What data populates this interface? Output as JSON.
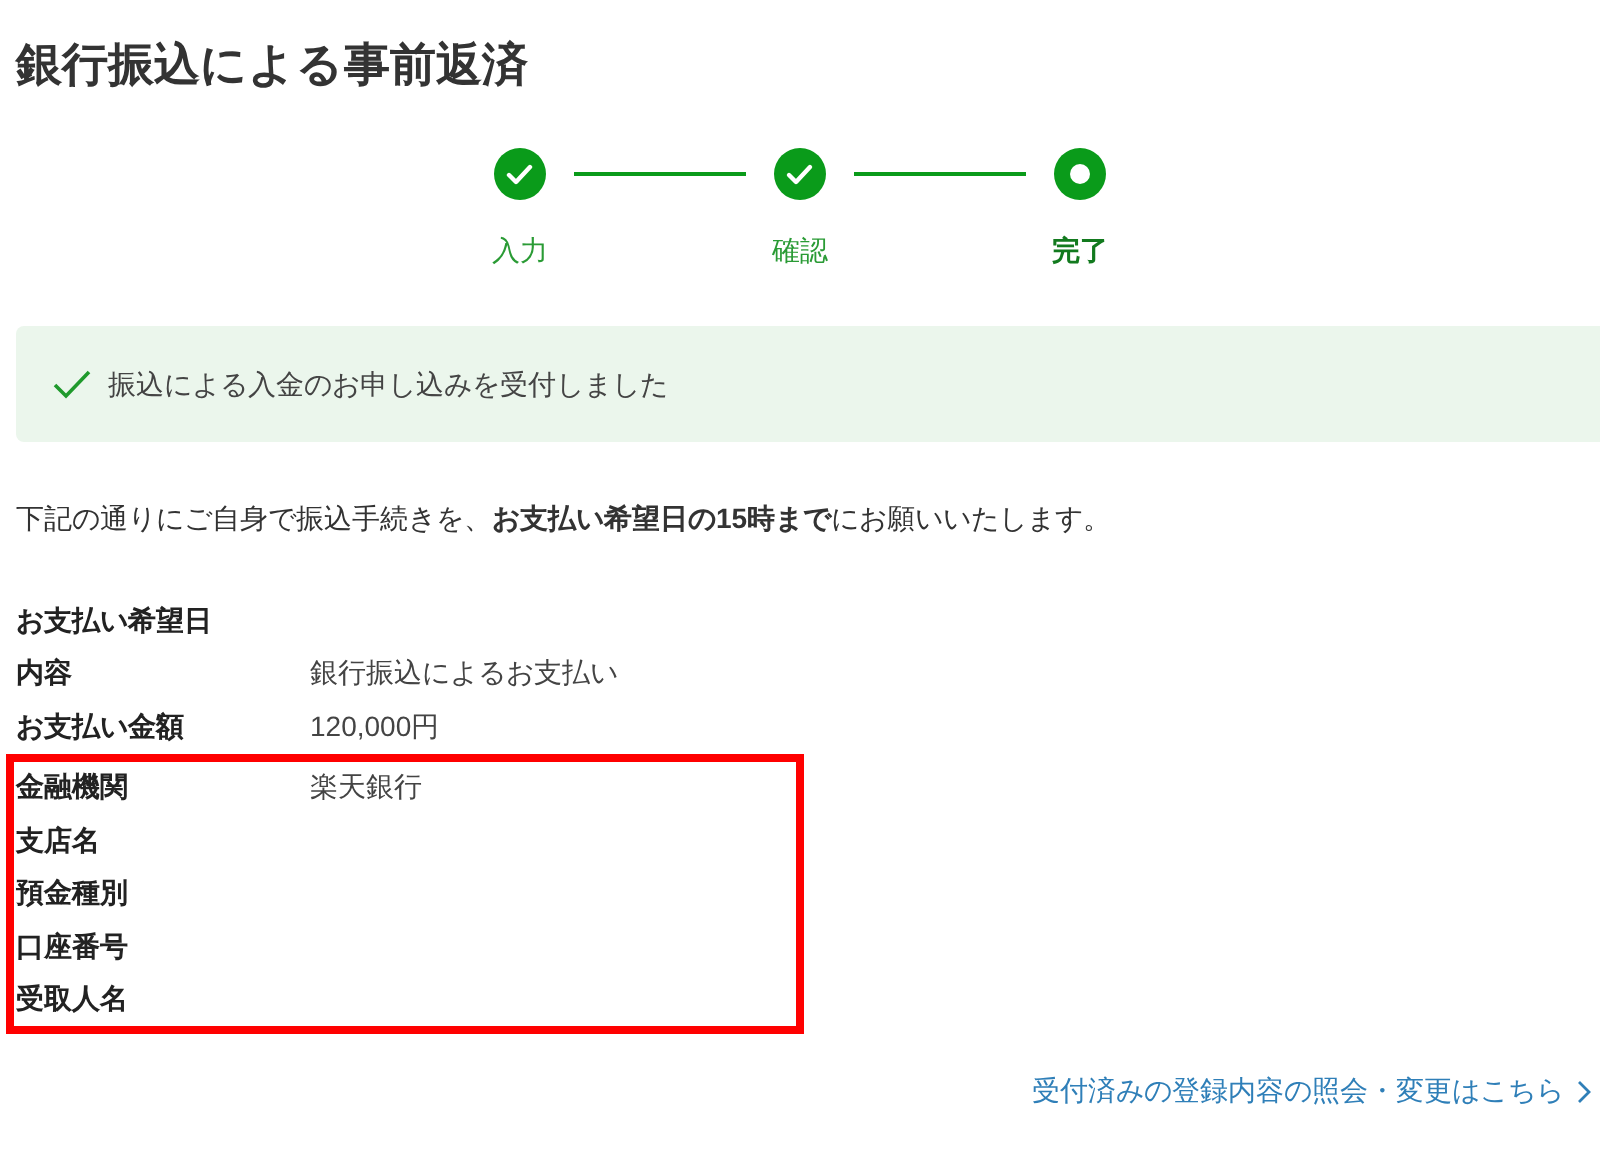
{
  "title": "銀行振込による事前返済",
  "steps": [
    {
      "label": "入力",
      "completed": true
    },
    {
      "label": "確認",
      "completed": true
    },
    {
      "label": "完了",
      "completed": false
    }
  ],
  "notice": "振込による入金のお申し込みを受付しました",
  "instruction": "下記の通りにご自身で振込手続きを、**お支払い希望日の15時まで**にお願いいたします。",
  "details": [
    {
      "label": "お支払い希望日"
    },
    {
      "label": "内容",
      "value": "銀行振込によるお支払い"
    },
    {
      "label": "お支払い金額",
      "value": "120,000円"
    }
  ],
  "highlighted_details": [
    {
      "label": "金融機関",
      "value": "楽天銀行"
    },
    {
      "label": "支店名"
    },
    {
      "label": "預金種別"
    },
    {
      "label": "口座番号"
    },
    {
      "label": "受取人名"
    }
  ],
  "link": "受付済みの登録内容の照会・変更はこちら"
}
